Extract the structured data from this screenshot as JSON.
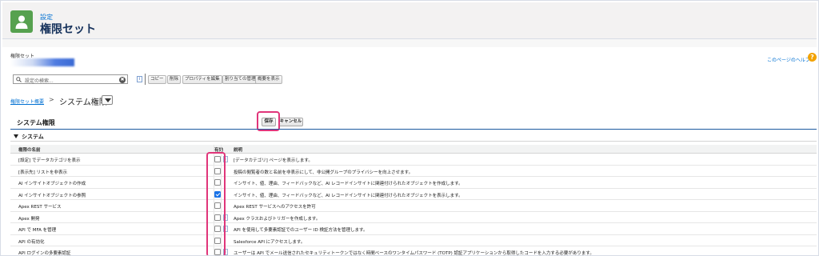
{
  "header": {
    "subtitle": "設定",
    "title": "権限セット"
  },
  "record": {
    "label": "権限セット"
  },
  "help": {
    "link_text": "このページのヘルプ",
    "icon_text": "?"
  },
  "toolbar": {
    "search_placeholder": "設定の検索...",
    "clear_icon": "✖",
    "info_icon": "i",
    "buttons": [
      "コピー",
      "削除",
      "プロパティを編集",
      "割り当ての管理",
      "概要を表示"
    ]
  },
  "breadcrumb": {
    "link": "権限セット概要",
    "separator": ">",
    "current": "システム権限"
  },
  "section": {
    "title": "システム権限",
    "save_label": "保存",
    "cancel_label": "キャンセル",
    "group_label": "システム"
  },
  "table": {
    "headers": {
      "name": "権限の名前",
      "enabled": "有効",
      "description": "説明"
    },
    "rows": [
      {
        "name": "[設定] でデータカテゴリを表示",
        "checked": false,
        "info": true,
        "desc": "[データカテゴリ] ページを表示します。"
      },
      {
        "name": "[表示先] リストを非表示",
        "checked": false,
        "info": false,
        "desc": "投稿の閲覧者の数と名前を非表示にして、非公開グループのプライバシーを向上させます。"
      },
      {
        "name": "AI インサイトオブジェクトの作成",
        "checked": false,
        "info": false,
        "desc": "インサイト、値、理由、フィードバックなど、AI レコードインサイトに関連付けられたオブジェクトを作成します。"
      },
      {
        "name": "AI インサイトオブジェクトの参照",
        "checked": true,
        "info": false,
        "desc": "インサイト、値、理由、フィードバックなど、AI レコードインサイトに関連付けられたオブジェクトを表示します。"
      },
      {
        "name": "Apex REST サービス",
        "checked": false,
        "info": false,
        "desc": "Apex REST サービスへのアクセスを許可"
      },
      {
        "name": "Apex 開発",
        "checked": false,
        "info": true,
        "desc": "Apex クラスおよびトリガーを作成します。"
      },
      {
        "name": "API で MFA を管理",
        "checked": false,
        "info": true,
        "desc": "API を使用して多要素認証でのユーザー ID 検証方法を管理します。"
      },
      {
        "name": "API の有効化",
        "checked": false,
        "info": false,
        "desc": "Salesforce API にアクセスします。"
      },
      {
        "name": "API ログインの多要素認証",
        "checked": false,
        "info": true,
        "desc": "ユーザーは API でメール送信されたセキュリティトークンではなく時間ベースのワンタイムパスワード (TOTP) 認証アプリケーションから取得したコードを入力する必要があります。"
      }
    ]
  },
  "colors": {
    "header_icon": "#56a14f",
    "link": "#0070d2",
    "highlight": "#e0357a",
    "checkbox_checked": "#1a73e8"
  },
  "icons": {
    "header": "user-icon",
    "search": "search-icon"
  }
}
